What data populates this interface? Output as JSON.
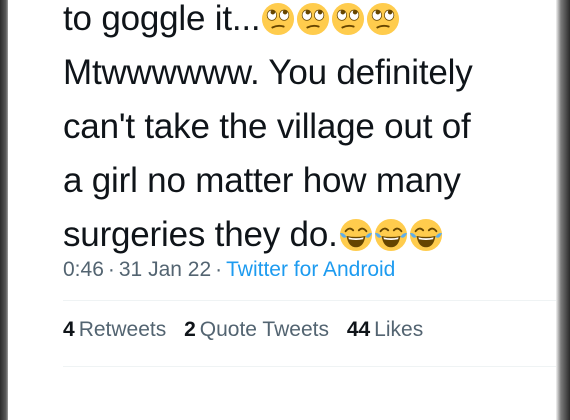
{
  "tweet": {
    "lines": [
      {
        "text": "to goggle it...",
        "emojis": [
          "rolling-eyes",
          "rolling-eyes",
          "rolling-eyes",
          "rolling-eyes"
        ]
      },
      {
        "text": "Mtwwwwww. You definitely",
        "emojis": []
      },
      {
        "text": "can't take the village out of",
        "emojis": []
      },
      {
        "text": "a girl no matter how many",
        "emojis": []
      },
      {
        "text": "surgeries they do.",
        "emojis": [
          "tears-of-joy",
          "tears-of-joy",
          "tears-of-joy"
        ]
      }
    ],
    "time": "0:46",
    "separator": "·",
    "date": "31 Jan 22",
    "source": "Twitter for Android",
    "stats": {
      "retweets_count": "4",
      "retweets_label": "Retweets",
      "quotes_count": "2",
      "quotes_label": "Quote Tweets",
      "likes_count": "44",
      "likes_label": "Likes"
    }
  },
  "colors": {
    "text": "#0f1419",
    "secondary": "#536471",
    "link": "#1d9bf0",
    "divider": "#eff3f4",
    "emoji_face": "#ffcc4d",
    "tear": "#5dadec"
  }
}
